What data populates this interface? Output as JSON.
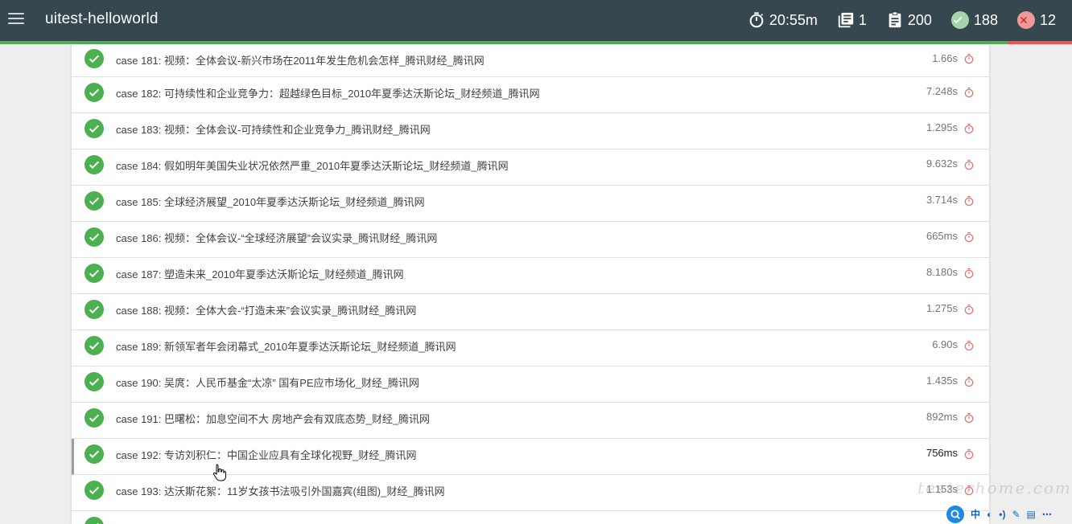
{
  "header": {
    "title": "uitest-helloworld",
    "elapsed": "20:55m",
    "suites": "1",
    "total": "200",
    "passed": "188",
    "failed": "12"
  },
  "colors": {
    "header_bg": "#37474f",
    "pass": "#4caf50",
    "fail": "#ef5350",
    "timer": "#e57373"
  },
  "progress": {
    "passed_fraction": 0.94
  },
  "cases": [
    {
      "label": "case 181: 视频：全体会议-新兴市场在2011年发生危机会怎样_腾讯财经_腾讯网",
      "duration": "1.66s"
    },
    {
      "label": "case 182: 可持续性和企业竞争力：超越绿色目标_2010年夏季达沃斯论坛_财经频道_腾讯网",
      "duration": "7.248s"
    },
    {
      "label": "case 183: 视频：全体会议-可持续性和企业竞争力_腾讯财经_腾讯网",
      "duration": "1.295s"
    },
    {
      "label": "case 184: 假如明年美国失业状况依然严重_2010年夏季达沃斯论坛_财经频道_腾讯网",
      "duration": "9.632s"
    },
    {
      "label": "case 185: 全球经济展望_2010年夏季达沃斯论坛_财经频道_腾讯网",
      "duration": "3.714s"
    },
    {
      "label": "case 186: 视频：全体会议-“全球经济展望”会议实录_腾讯财经_腾讯网",
      "duration": "665ms"
    },
    {
      "label": "case 187: 塑造未来_2010年夏季达沃斯论坛_财经频道_腾讯网",
      "duration": "8.180s"
    },
    {
      "label": "case 188: 视频：全体大会-“打造未来”会议实录_腾讯财经_腾讯网",
      "duration": "1.275s"
    },
    {
      "label": "case 189: 新领军者年会闭幕式_2010年夏季达沃斯论坛_财经频道_腾讯网",
      "duration": "6.90s"
    },
    {
      "label": "case 190: 吴庹：人民币基金“太凉” 国有PE应市场化_财经_腾讯网",
      "duration": "1.435s"
    },
    {
      "label": "case 191: 巴曙松：加息空间不大 房地产会有双底态势_财经_腾讯网",
      "duration": "892ms"
    },
    {
      "label": "case 192: 专访刘积仁：中国企业应具有全球化视野_财经_腾讯网",
      "duration": "756ms"
    },
    {
      "label": "case 193: 达沃斯花絮：11岁女孩书法吸引外国嘉宾(组图)_财经_腾讯网",
      "duration": "1.153s"
    },
    {
      "label": "",
      "duration": ""
    }
  ],
  "ime": {
    "chars": [
      "中",
      "◐",
      "•)",
      "✎",
      "▤",
      "⋯"
    ]
  }
}
